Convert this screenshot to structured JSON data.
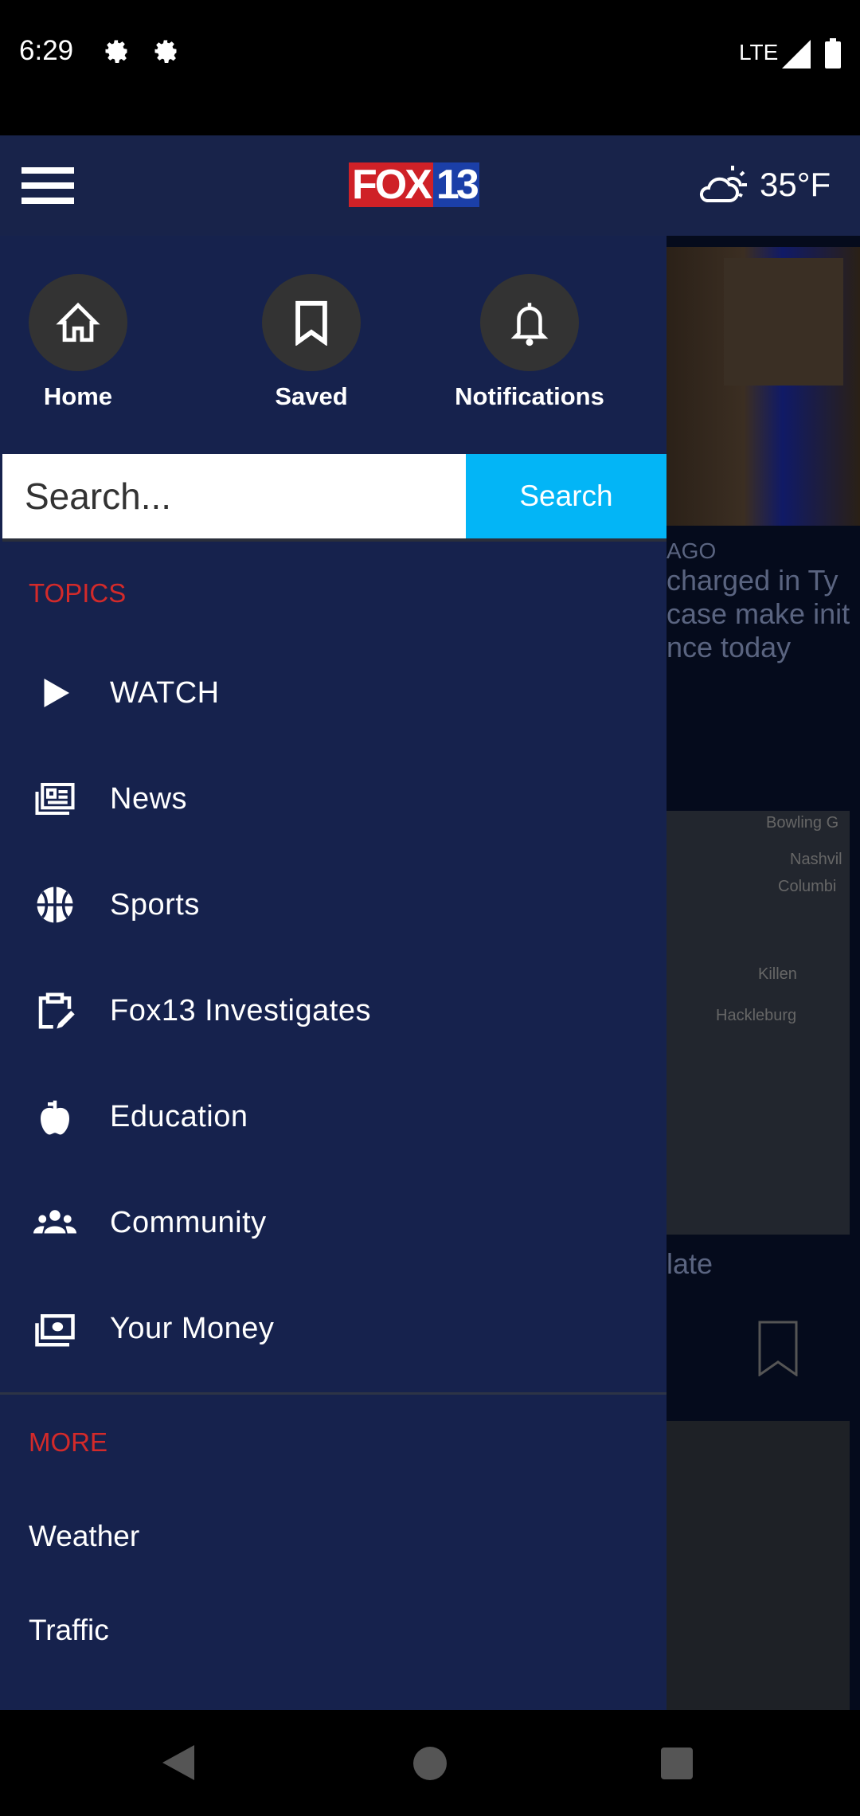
{
  "status_bar": {
    "time": "6:29",
    "network": "LTE",
    "icons": [
      "gear-icon",
      "gear-icon",
      "signal-icon",
      "battery-icon"
    ]
  },
  "header": {
    "logo": {
      "part1": "FOX",
      "part2": "13"
    },
    "weather": {
      "icon": "partly-cloudy-icon",
      "temp": "35°F"
    }
  },
  "quick_actions": [
    {
      "label": "Home",
      "icon": "home-icon"
    },
    {
      "label": "Saved",
      "icon": "bookmark-icon"
    },
    {
      "label": "Notifications",
      "icon": "bell-icon"
    }
  ],
  "search": {
    "placeholder": "Search...",
    "button": "Search"
  },
  "topics": {
    "heading": "TOPICS",
    "items": [
      {
        "label": "WATCH",
        "icon": "play-icon"
      },
      {
        "label": "News",
        "icon": "newspaper-icon"
      },
      {
        "label": "Sports",
        "icon": "basketball-icon"
      },
      {
        "label": "Fox13 Investigates",
        "icon": "clipboard-edit-icon"
      },
      {
        "label": "Education",
        "icon": "apple-icon"
      },
      {
        "label": "Community",
        "icon": "users-icon"
      },
      {
        "label": "Your Money",
        "icon": "money-icon"
      }
    ]
  },
  "more": {
    "heading": "MORE",
    "items": [
      {
        "label": "Weather"
      },
      {
        "label": "Traffic"
      }
    ]
  },
  "background": {
    "story1": {
      "time": "AGO",
      "title_lines": [
        "charged in Ty",
        "case make init",
        "nce today"
      ]
    },
    "story2": {
      "title": "late"
    },
    "map_labels": [
      "Bowling G",
      "Nashvil",
      "Columbi",
      "Killen",
      "Hackleburg"
    ]
  },
  "colors": {
    "drawer": "#16224d",
    "header": "#18234a",
    "accent": "#03b5f6",
    "section": "#d32a2a"
  }
}
